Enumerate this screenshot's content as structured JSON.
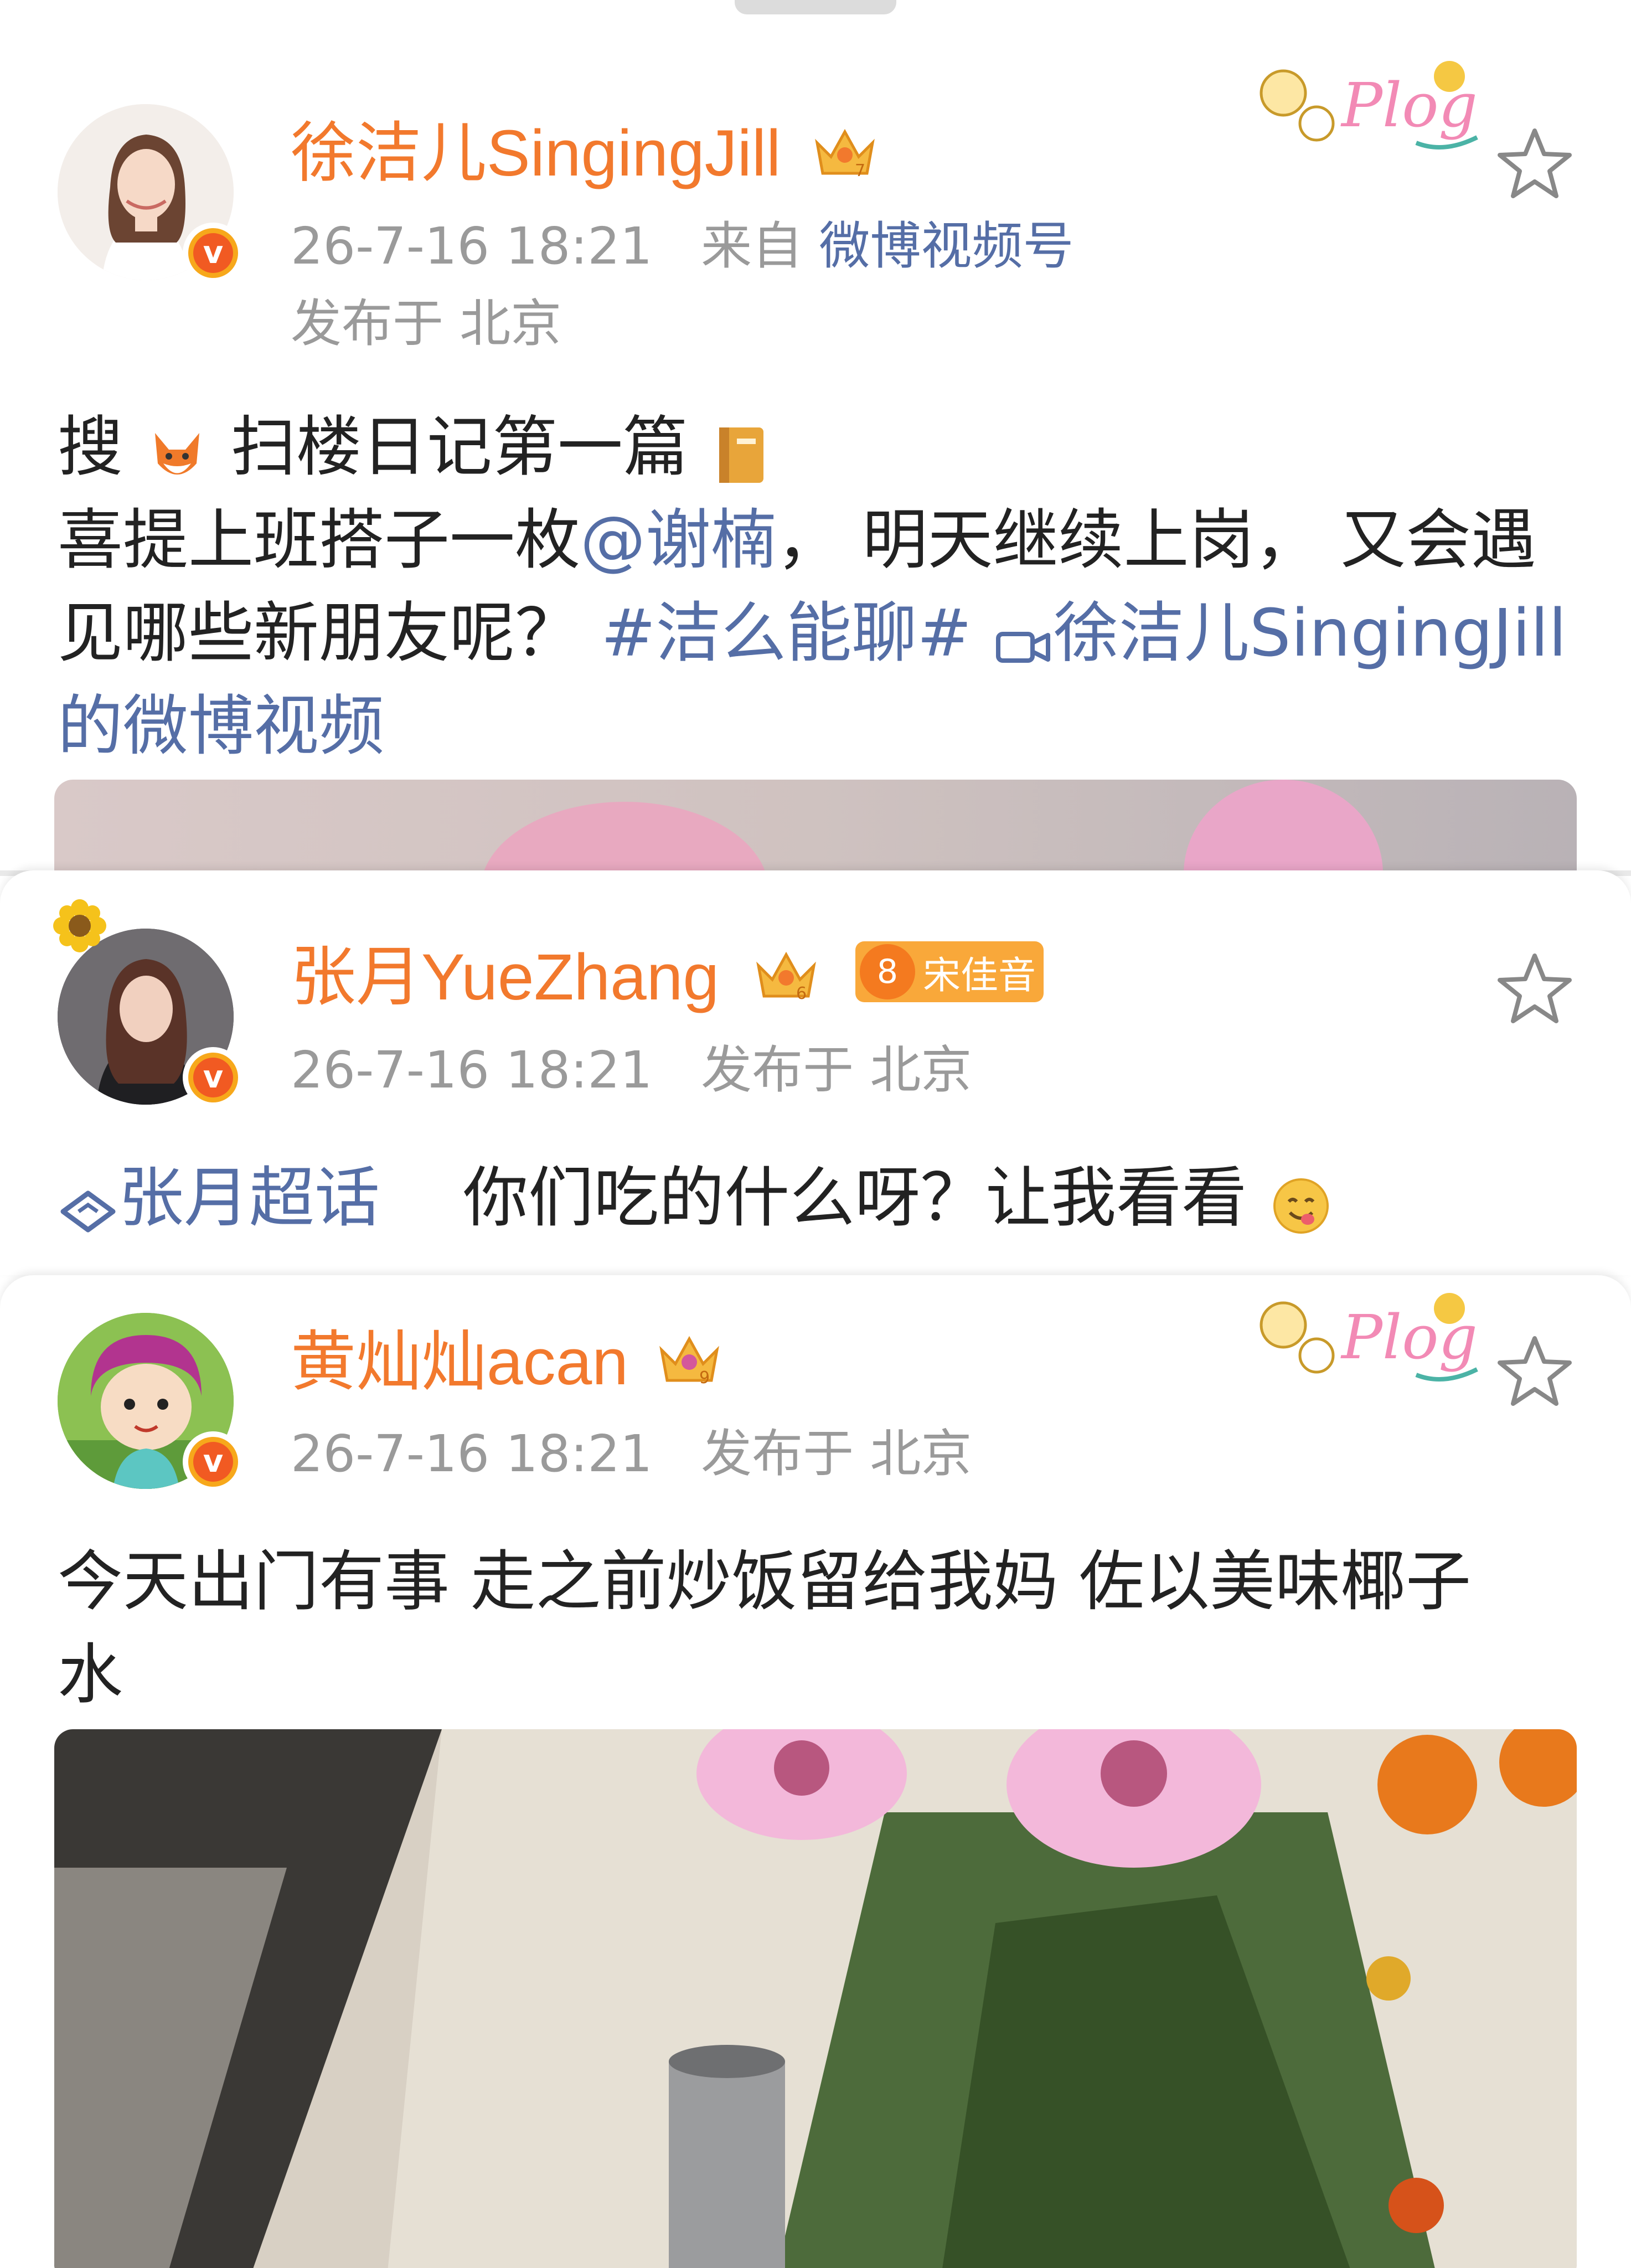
{
  "posts": [
    {
      "username": "徐洁儿SingingJill",
      "crown_level": "7",
      "time": "26-7-16 18:21",
      "source_prefix": "来自",
      "source": "微博视频号",
      "location": "发布于 北京",
      "text_line1": "搜",
      "text_line1_b": "扫楼日记第一篇",
      "text_line2_a": "喜提上班搭子一枚",
      "mention": "@谢楠",
      "text_line2_b": "，  明天继续上岗，  又会遇",
      "text_line3_a": "见哪些新朋友呢？",
      "hashtag": "#洁么能聊#",
      "video_link": "徐洁儿SingingJill",
      "text_line4": "的微博视频",
      "plog": "Plog"
    },
    {
      "username": "张月YueZhang",
      "crown_level": "6",
      "fan_level": "8",
      "fan_badge": "宋佳音",
      "time": "26-7-16 18:21",
      "location": "发布于 北京",
      "topic": "张月超话",
      "text": "你们吃的什么呀？让我看看"
    },
    {
      "username": "黄灿灿acan",
      "crown_level": "9",
      "time": "26-7-16 18:21",
      "location": "发布于 北京",
      "text_line1": "今天出门有事 走之前炒饭留给我妈 佐以美味椰子",
      "text_line2": "水",
      "plog": "Plog"
    }
  ],
  "colors": {
    "name": "#f2792d",
    "link": "#556ea6",
    "meta": "#9a9a9a",
    "vbadge": "#f15a22"
  }
}
